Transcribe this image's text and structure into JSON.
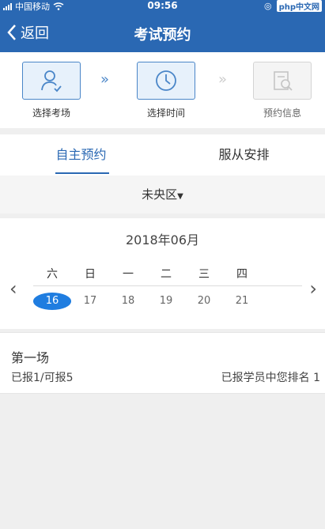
{
  "status_bar": {
    "carrier": "中国移动",
    "time": "09:56",
    "watermark": "php中文网"
  },
  "nav": {
    "back_label": "返回",
    "title": "考试预约"
  },
  "steps": [
    {
      "label": "选择考场",
      "icon": "person-icon",
      "state": "done"
    },
    {
      "label": "选择时间",
      "icon": "clock-icon",
      "state": "active"
    },
    {
      "label": "预约信息",
      "icon": "document-search-icon",
      "state": "disabled"
    }
  ],
  "tabs": [
    {
      "label": "自主预约",
      "active": true
    },
    {
      "label": "服从安排",
      "active": false
    }
  ],
  "area": {
    "label": "未央区"
  },
  "calendar": {
    "month": "2018年06月",
    "weekdays": [
      "六",
      "日",
      "一",
      "二",
      "三",
      "四"
    ],
    "dates": [
      "16",
      "17",
      "18",
      "19",
      "20",
      "21"
    ],
    "selected_index": 0
  },
  "session": {
    "title": "第一场",
    "quota": "已报1/可报5",
    "rank": "已报学员中您排名  1"
  }
}
